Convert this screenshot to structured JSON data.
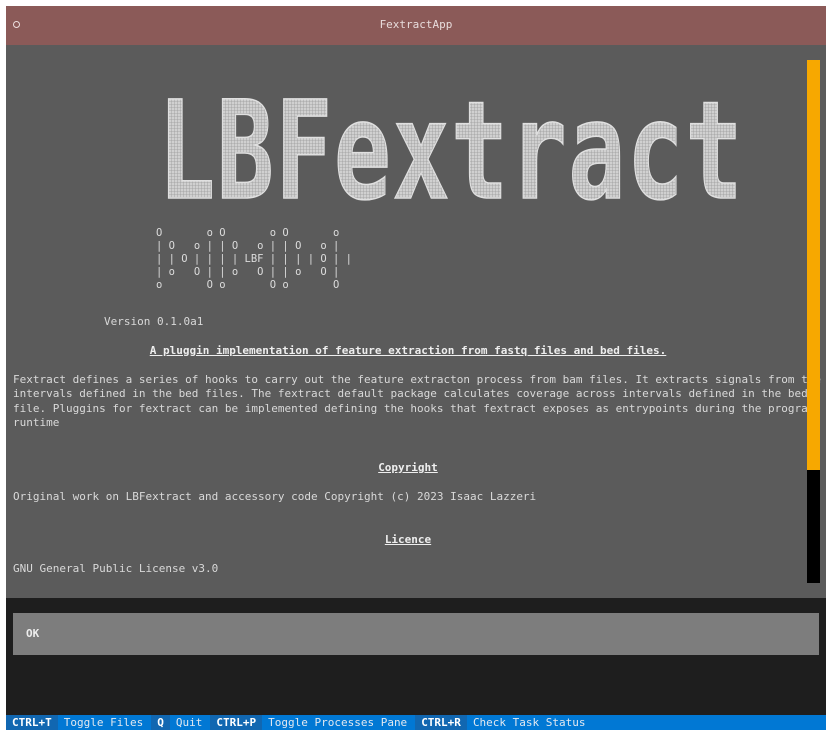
{
  "window": {
    "title": "FextractApp"
  },
  "about": {
    "banner_text": "LBFextract",
    "ascii_lines": [
      "O       o O       o O       o",
      "| O   o | | O   o | | O   o |",
      "| | O | | | | LBF | | | | O | |",
      "| o   O | | o   O | | o   O |",
      "o       O o       O o       O"
    ],
    "version": "Version 0.1.0a1",
    "heading": "A pluggin implementation of feature extraction from fastq files and bed files.",
    "description_lines": [
      "Fextract defines a series of hooks to carry out the feature extracton process from bam files. It extracts signals from the",
      "intervals defined in the bed files. The fextract default package calculates coverage across intervals defined in the bed",
      "file. Pluggins for fextract can be implemented defining the hooks that fextract exposes as entrypoints during the program",
      "runtime"
    ],
    "copyright_heading": "Copyright",
    "copyright_text": "Original work on LBFextract and accessory code Copyright (c) 2023 Isaac Lazzeri",
    "licence_heading": "Licence",
    "licence_text": "GNU General Public License v3.0"
  },
  "ok_button": {
    "label": "OK"
  },
  "footer": {
    "bindings": [
      {
        "key": "CTRL+T",
        "label": "Toggle Files"
      },
      {
        "key": "Q",
        "label": "Quit"
      },
      {
        "key": "CTRL+P",
        "label": "Toggle Processes Pane"
      },
      {
        "key": "CTRL+R",
        "label": "Check Task Status"
      }
    ]
  },
  "colors": {
    "titlebar": "#8b5a58",
    "content_bg": "#5b5b5b",
    "scrollbar_thumb": "#f7a800",
    "footer_bg": "#0178d4",
    "footer_key_bg": "#1167b1"
  }
}
